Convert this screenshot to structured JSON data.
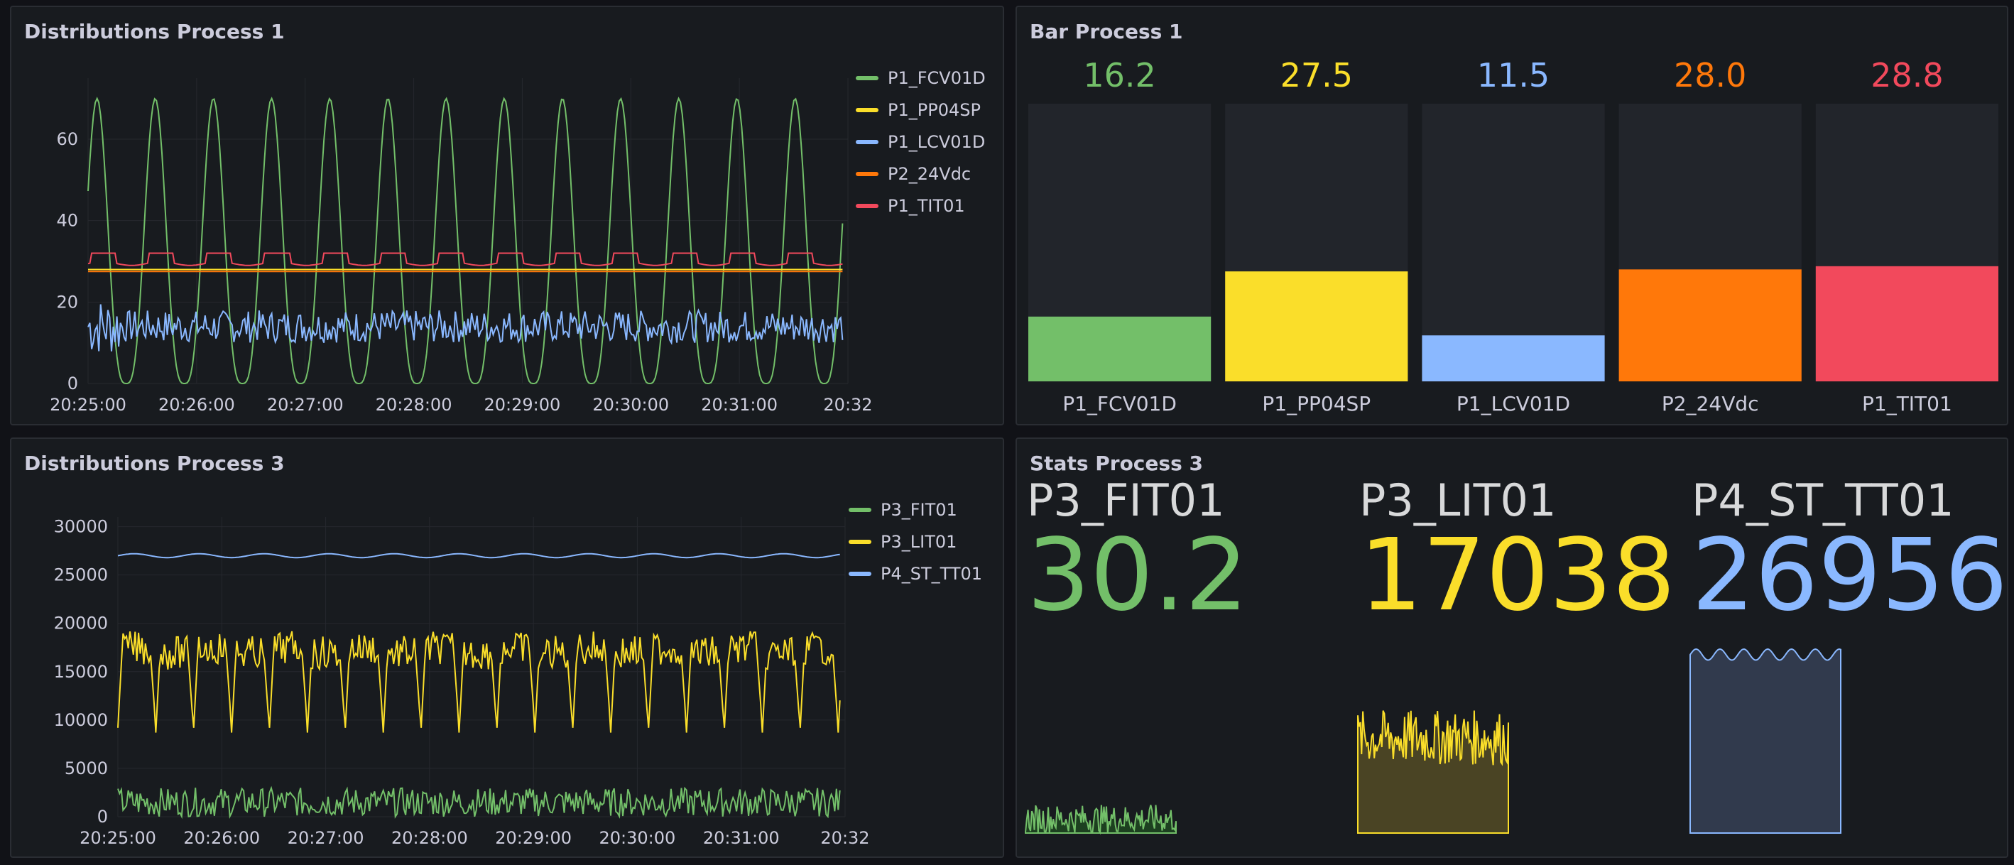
{
  "panels": {
    "p1": {
      "title": "Distributions Process 1"
    },
    "p2": {
      "title": "Bar Process 1"
    },
    "p3": {
      "title": "Distributions Process 3"
    },
    "p4": {
      "title": "Stats Process 3"
    }
  },
  "chart_data": [
    {
      "type": "line",
      "title": "Distributions Process 1",
      "x_ticks": [
        "20:25:00",
        "20:26:00",
        "20:27:00",
        "20:28:00",
        "20:29:00",
        "20:30:00",
        "20:31:00",
        "20:32"
      ],
      "ylim": [
        0,
        75
      ],
      "y_ticks": [
        0,
        20,
        40,
        60
      ],
      "grid": true,
      "legend_position": "right",
      "series": [
        {
          "name": "P1_FCV01D",
          "color": "#73bf69",
          "shape": "periodic",
          "min": 0,
          "max": 70,
          "cycles": 13
        },
        {
          "name": "P1_PP04SP",
          "color": "#fade2a",
          "shape": "flat",
          "value": 28
        },
        {
          "name": "P1_LCV01D",
          "color": "#8ab8ff",
          "shape": "noise",
          "mean": 14,
          "spread": 4
        },
        {
          "name": "P2_24Vdc",
          "color": "#ff780a",
          "shape": "flat",
          "value": 27.5
        },
        {
          "name": "P1_TIT01",
          "color": "#f2495c",
          "shape": "periodic-small",
          "min": 29,
          "max": 32
        }
      ]
    },
    {
      "type": "bar",
      "title": "Bar Process 1",
      "categories": [
        "P1_FCV01D",
        "P1_PP04SP",
        "P1_LCV01D",
        "P2_24Vdc",
        "P1_TIT01"
      ],
      "values": [
        16.2,
        27.5,
        11.5,
        28.0,
        28.8
      ],
      "value_labels": [
        "16.2",
        "27.5",
        "11.5",
        "28.0",
        "28.8"
      ],
      "colors": [
        "#73bf69",
        "#fade2a",
        "#8ab8ff",
        "#ff780a",
        "#f2495c"
      ],
      "ylim": [
        0,
        100
      ]
    },
    {
      "type": "line",
      "title": "Distributions Process 3",
      "x_ticks": [
        "20:25:00",
        "20:26:00",
        "20:27:00",
        "20:28:00",
        "20:29:00",
        "20:30:00",
        "20:31:00",
        "20:32"
      ],
      "ylim": [
        0,
        31000
      ],
      "y_ticks": [
        0,
        5000,
        10000,
        15000,
        20000,
        25000,
        30000
      ],
      "grid": true,
      "legend_position": "right",
      "series": [
        {
          "name": "P3_FIT01",
          "color": "#73bf69",
          "shape": "noise-spiky",
          "mean": 1500,
          "spread": 1500
        },
        {
          "name": "P3_LIT01",
          "color": "#fade2a",
          "shape": "plateau",
          "min": 9000,
          "max": 19000
        },
        {
          "name": "P4_ST_TT01",
          "color": "#8ab8ff",
          "shape": "flat-wavy",
          "value": 27000
        }
      ]
    },
    {
      "type": "stat",
      "title": "Stats Process 3",
      "items": [
        {
          "name": "P3_FIT01",
          "value": "30.2",
          "color": "#73bf69",
          "spark_fill": "#1d4020",
          "spark_shape": "noise-spiky"
        },
        {
          "name": "P3_LIT01",
          "value": "17038",
          "color": "#fade2a",
          "spark_fill": "#4a4424",
          "spark_shape": "plateau"
        },
        {
          "name": "P4_ST_TT01",
          "value": "26956",
          "color": "#8ab8ff",
          "spark_fill": "#313a4d",
          "spark_shape": "flat-wavy"
        }
      ]
    }
  ]
}
